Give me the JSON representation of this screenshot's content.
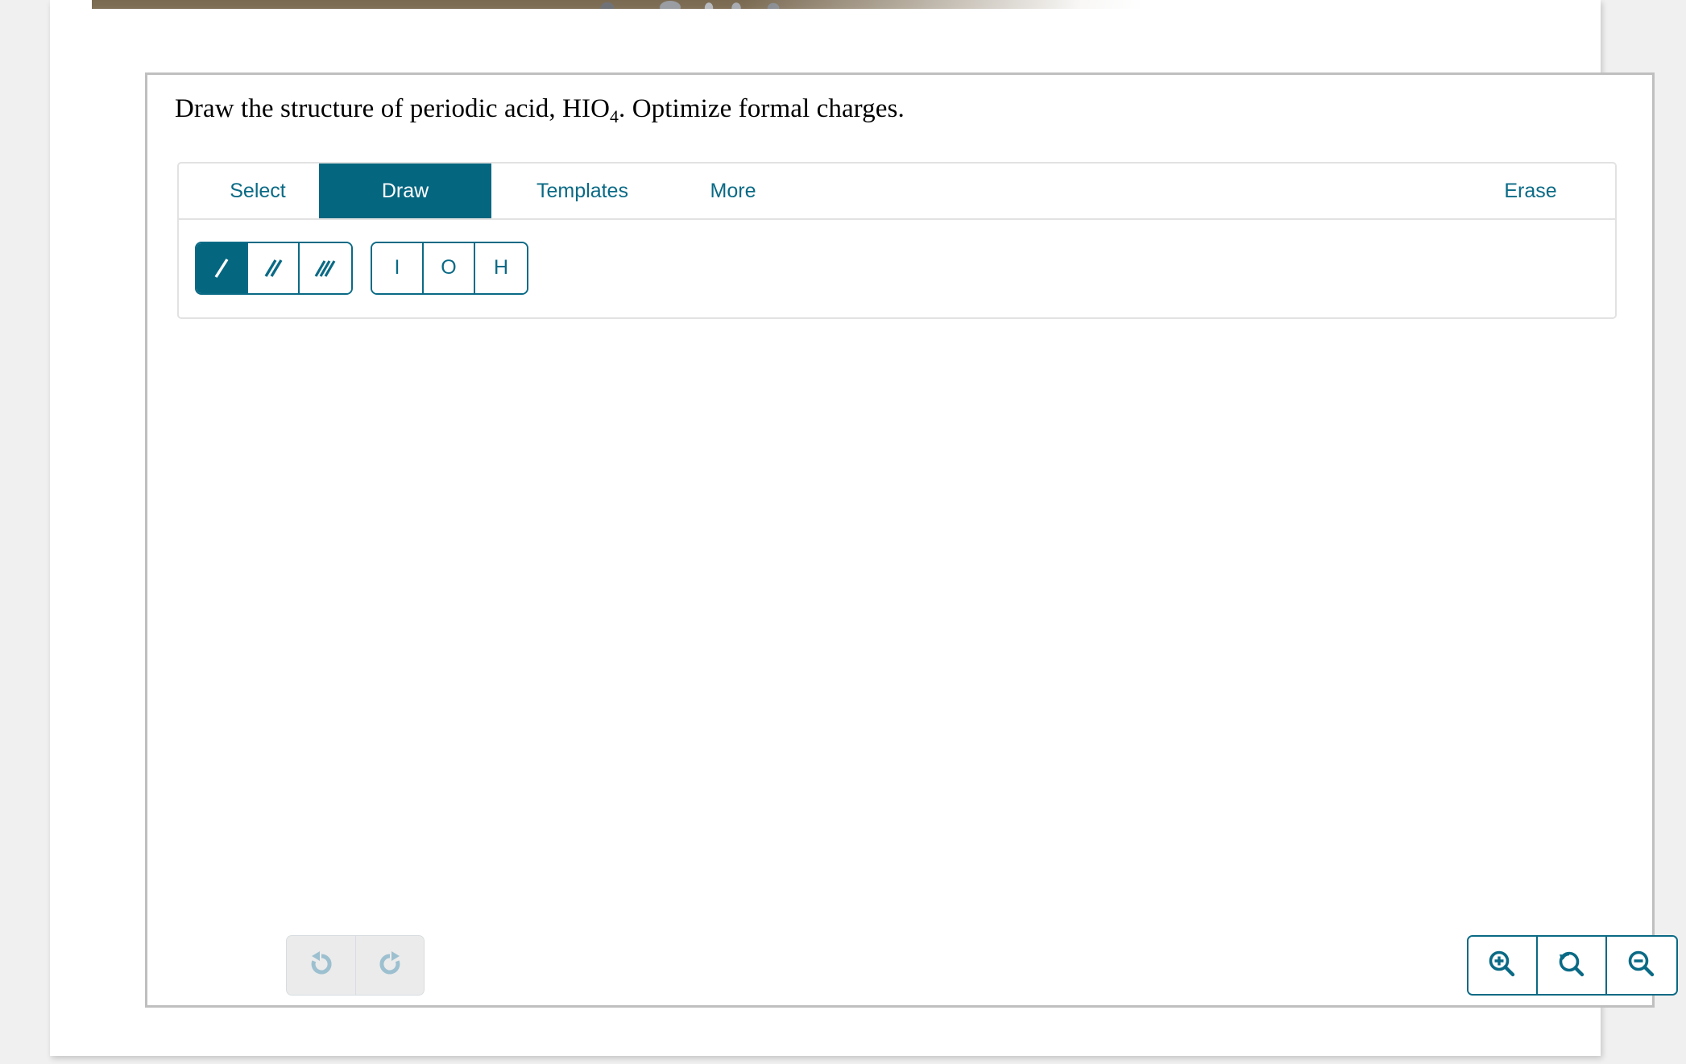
{
  "page": {
    "background_color": "#f0f0f0",
    "sheet_color": "#ffffff"
  },
  "banner": {
    "name": "cropped-header-image",
    "description": "partially visible cut-off photographic banner strip",
    "dominant_color": "#7a6a52"
  },
  "question": {
    "prompt_prefix": "Draw the structure of periodic acid, HIO",
    "formula_subscript": "4",
    "prompt_suffix": ". Optimize formal charges."
  },
  "editor": {
    "accent_color": "#056680",
    "tabs": [
      {
        "id": "select",
        "label": "Select",
        "active": false
      },
      {
        "id": "draw",
        "label": "Draw",
        "active": true
      },
      {
        "id": "templates",
        "label": "Templates",
        "active": false
      },
      {
        "id": "more",
        "label": "More",
        "active": false
      }
    ],
    "erase": {
      "id": "erase",
      "label": "Erase"
    },
    "bond_tools": [
      {
        "id": "single-bond",
        "icon": "single-bond-icon",
        "label": "Single bond",
        "active": true
      },
      {
        "id": "double-bond",
        "icon": "double-bond-icon",
        "label": "Double bond",
        "active": false
      },
      {
        "id": "triple-bond",
        "icon": "triple-bond-icon",
        "label": "Triple bond",
        "active": false
      }
    ],
    "element_tools": [
      {
        "id": "element-i",
        "label": "I",
        "active": false
      },
      {
        "id": "element-o",
        "label": "O",
        "active": false
      },
      {
        "id": "element-h",
        "label": "H",
        "active": false
      }
    ],
    "history_controls": [
      {
        "id": "undo",
        "icon": "undo-icon",
        "label": "Undo",
        "disabled": true
      },
      {
        "id": "redo",
        "icon": "redo-icon",
        "label": "Redo",
        "disabled": true
      }
    ],
    "zoom_controls": [
      {
        "id": "zoom-in",
        "icon": "zoom-in-icon",
        "label": "Zoom in"
      },
      {
        "id": "zoom-reset",
        "icon": "zoom-reset-icon",
        "label": "Reset zoom"
      },
      {
        "id": "zoom-out",
        "icon": "zoom-out-icon",
        "label": "Zoom out"
      }
    ],
    "canvas": {
      "id": "molecule-canvas",
      "content": ""
    }
  }
}
